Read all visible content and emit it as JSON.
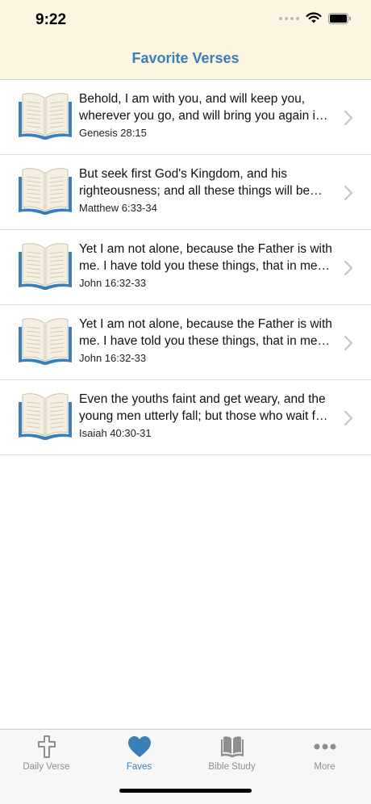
{
  "status": {
    "time": "9:22"
  },
  "nav": {
    "title": "Favorite Verses"
  },
  "verses": [
    {
      "text": "Behold, I am with you, and will keep you, wherever you go, and will bring you again into this land.",
      "ref": "Genesis 28:15"
    },
    {
      "text": "But seek first God's Kingdom, and his righteousness; and all these things will be given to you as well.",
      "ref": "Matthew 6:33-34"
    },
    {
      "text": "Yet I am not alone, because the Father is with me. I have told you these things, that in me you may have peace.",
      "ref": "John 16:32-33"
    },
    {
      "text": "Yet I am not alone, because the Father is with me. I have told you these things, that in me you may have peace.",
      "ref": "John 16:32-33"
    },
    {
      "text": "Even the youths faint and get weary, and the young men utterly fall; but those who wait for Yahweh will renew their strength.",
      "ref": "Isaiah 40:30-31"
    }
  ],
  "tabs": [
    {
      "label": "Daily Verse",
      "icon": "cross-icon"
    },
    {
      "label": "Faves",
      "icon": "heart-icon"
    },
    {
      "label": "Bible Study",
      "icon": "book-icon"
    },
    {
      "label": "More",
      "icon": "more-icon"
    }
  ],
  "colors": {
    "accent": "#3a7fb5",
    "header_bg": "#fbf5e1",
    "inactive_tab": "#8e8e8e"
  }
}
